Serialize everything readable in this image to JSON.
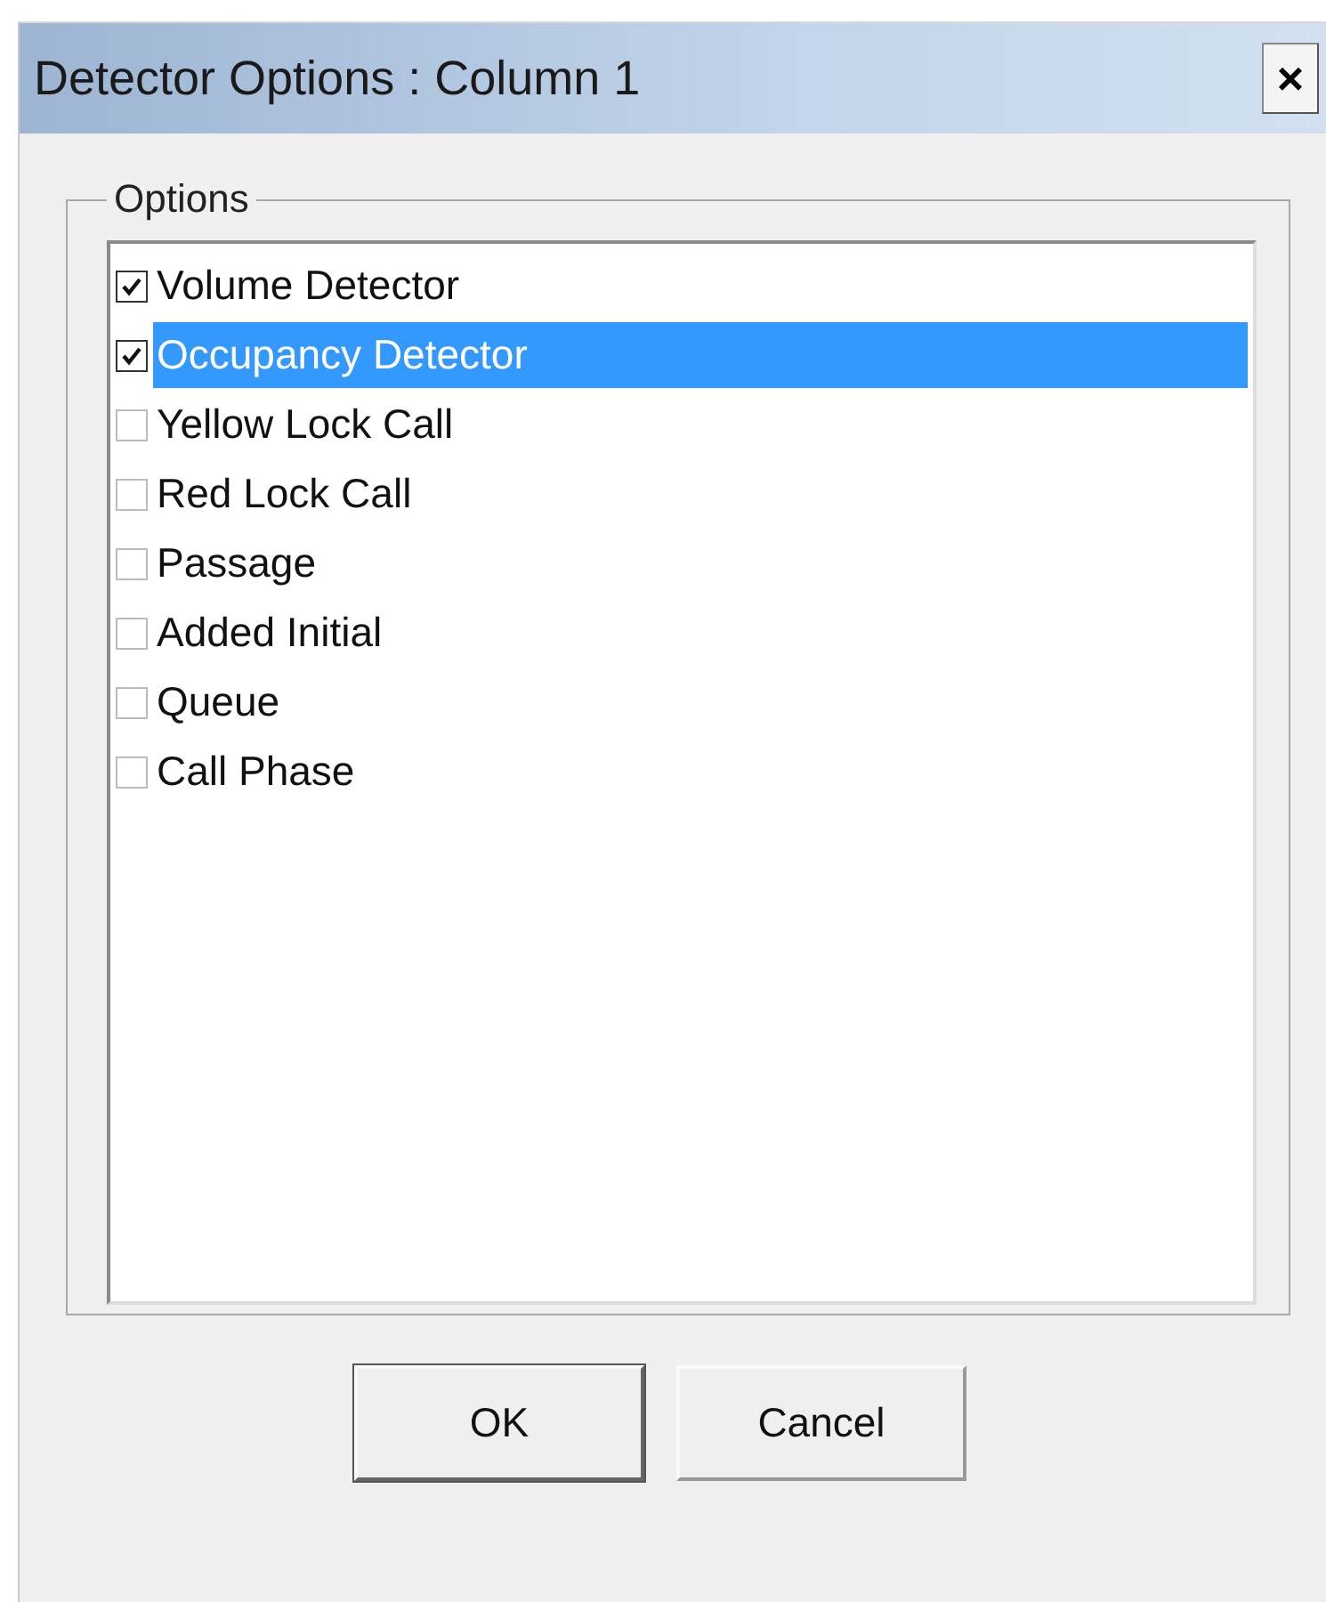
{
  "window": {
    "title": "Detector Options : Column 1",
    "close": "×"
  },
  "group": {
    "label": "Options"
  },
  "options": [
    {
      "label": "Volume Detector",
      "checked": true,
      "selected": false
    },
    {
      "label": "Occupancy Detector",
      "checked": true,
      "selected": true
    },
    {
      "label": "Yellow Lock Call",
      "checked": false,
      "selected": false
    },
    {
      "label": "Red Lock Call",
      "checked": false,
      "selected": false
    },
    {
      "label": "Passage",
      "checked": false,
      "selected": false
    },
    {
      "label": "Added Initial",
      "checked": false,
      "selected": false
    },
    {
      "label": "Queue",
      "checked": false,
      "selected": false
    },
    {
      "label": "Call Phase",
      "checked": false,
      "selected": false
    }
  ],
  "buttons": [
    {
      "label": "OK",
      "default": true
    },
    {
      "label": "Cancel",
      "default": false
    }
  ]
}
